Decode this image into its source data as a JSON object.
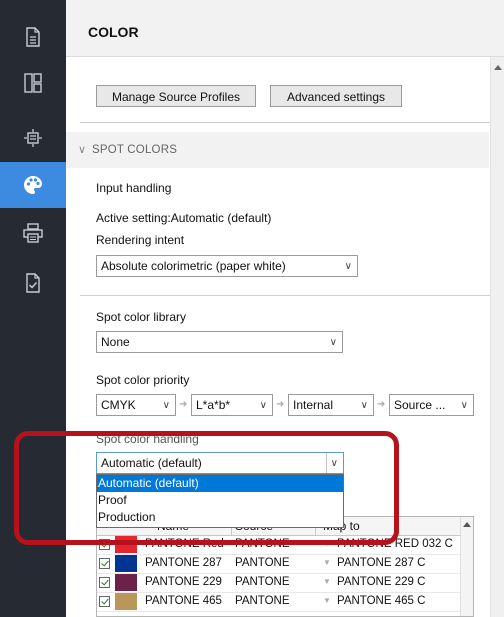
{
  "sidebar": {
    "items": [
      {
        "icon": "document-icon",
        "active": false
      },
      {
        "icon": "layout-panels-icon",
        "active": false
      },
      {
        "icon": "page-setup-icon",
        "active": false
      },
      {
        "icon": "palette-icon",
        "active": true
      },
      {
        "icon": "printer-icon",
        "active": false
      },
      {
        "icon": "checked-document-icon",
        "active": false
      }
    ]
  },
  "header": {
    "title": "COLOR"
  },
  "buttons": {
    "manage_source_profiles": "Manage Source Profiles",
    "advanced_settings": "Advanced settings"
  },
  "section": {
    "title": "SPOT COLORS"
  },
  "fields": {
    "input_handling_label": "Input handling",
    "active_setting": "Active setting:Automatic (default)",
    "rendering_intent_label": "Rendering intent",
    "rendering_intent_value": "Absolute colorimetric (paper white)",
    "spot_library_label": "Spot color library",
    "spot_library_value": "None",
    "spot_priority_label": "Spot color priority",
    "priority": [
      "CMYK",
      "L*a*b*",
      "Internal",
      "Source ..."
    ],
    "spot_handling_label": "Spot color handling",
    "spot_handling_value": "Automatic (default)"
  },
  "dropdown": {
    "options": [
      "Automatic (default)",
      "Proof",
      "Production"
    ],
    "selected_index": 0
  },
  "table": {
    "headers": [
      "Name",
      "Source",
      "Map to"
    ],
    "rows": [
      {
        "name": "PANTONE Red",
        "source": "PANTONE",
        "map": "PANTONE RED 032 C",
        "color": "#e3262f"
      },
      {
        "name": "PANTONE 287",
        "source": "PANTONE",
        "map": "PANTONE 287 C",
        "color": "#003594"
      },
      {
        "name": "PANTONE 229",
        "source": "PANTONE",
        "map": "PANTONE 229 C",
        "color": "#6b2148"
      },
      {
        "name": "PANTONE 465",
        "source": "PANTONE",
        "map": "PANTONE 465 C",
        "color": "#b9975b"
      }
    ]
  },
  "colors": {
    "sidebar_bg": "#262b33",
    "active_accent": "#3d8be0",
    "highlight_red": "#b5121b",
    "selection_blue": "#0078d7"
  }
}
